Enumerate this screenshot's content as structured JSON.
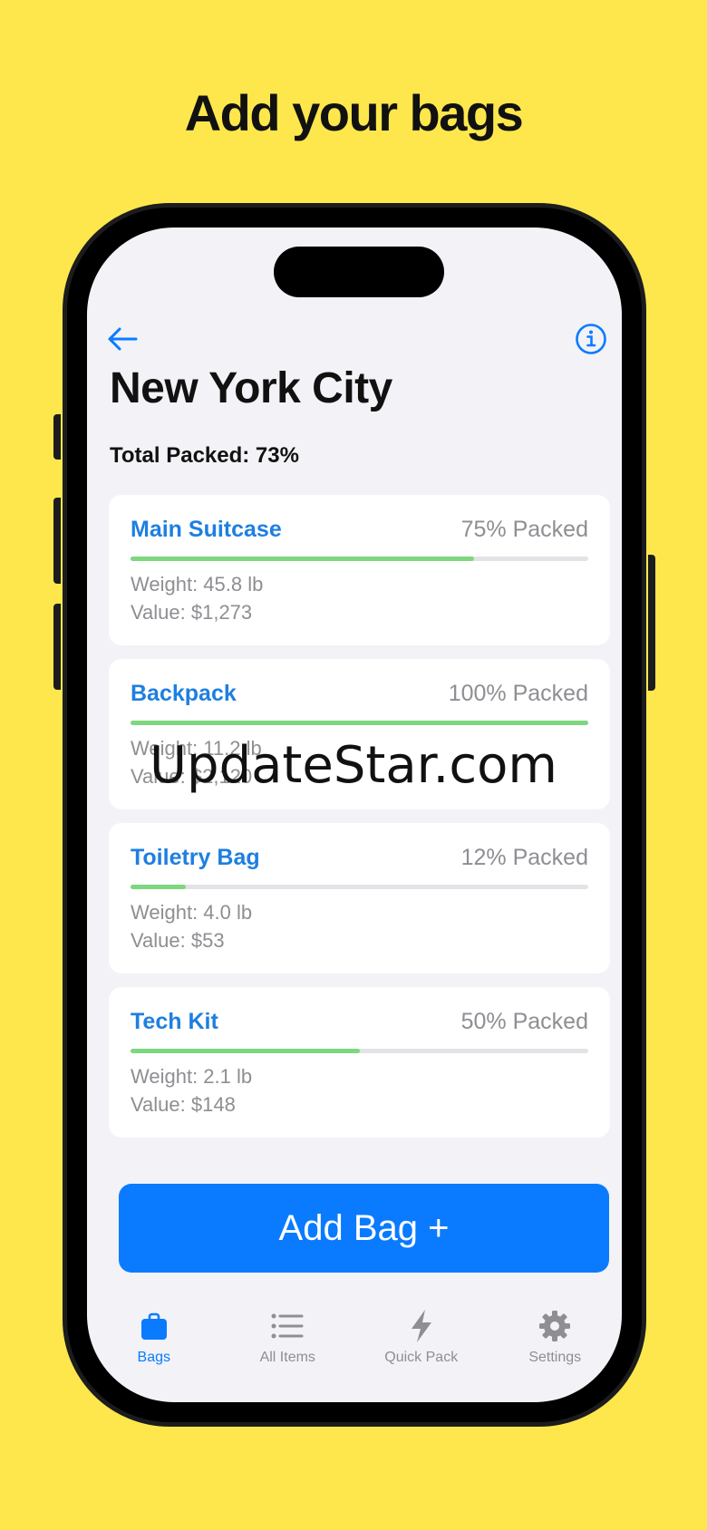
{
  "headline": "Add your bags",
  "trip": {
    "title": "New York City",
    "total_packed": "Total Packed: 73%"
  },
  "bags": [
    {
      "name": "Main Suitcase",
      "percent_label": "75% Packed",
      "percent": 75,
      "weight": "Weight: 45.8 lb",
      "value": "Value: $1,273"
    },
    {
      "name": "Backpack",
      "percent_label": "100% Packed",
      "percent": 100,
      "weight": "Weight: 11.2 lb",
      "value": "Value: $2,120"
    },
    {
      "name": "Toiletry Bag",
      "percent_label": "12% Packed",
      "percent": 12,
      "weight": "Weight: 4.0 lb",
      "value": "Value: $53"
    },
    {
      "name": "Tech Kit",
      "percent_label": "50% Packed",
      "percent": 50,
      "weight": "Weight: 2.1 lb",
      "value": "Value: $148"
    }
  ],
  "add_button": "Add Bag +",
  "tabs": [
    {
      "label": "Bags",
      "icon": "bag-icon",
      "active": true
    },
    {
      "label": "All Items",
      "icon": "list-icon",
      "active": false
    },
    {
      "label": "Quick Pack",
      "icon": "bolt-icon",
      "active": false
    },
    {
      "label": "Settings",
      "icon": "gear-icon",
      "active": false
    }
  ],
  "watermark": "UpdateStar.com",
  "colors": {
    "background": "#FDE74C",
    "accent": "#0A7BFF",
    "progress": "#7ED77E"
  }
}
